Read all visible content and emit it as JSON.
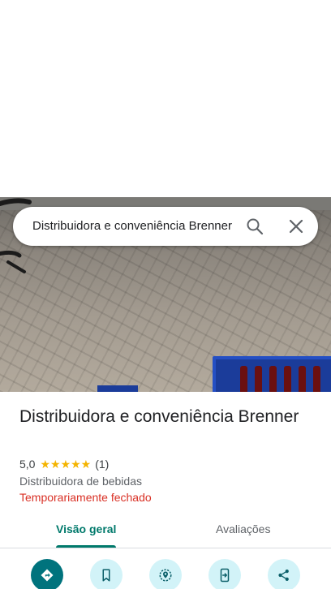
{
  "search": {
    "query": "Distribuidora e conveniência Brenner"
  },
  "place": {
    "title": "Distribuidora e conveniência Brenner",
    "rating": "5,0",
    "stars": "★★★★★",
    "review_count": "(1)",
    "category": "Distribuidora de bebidas",
    "status": "Temporariamente fechado"
  },
  "tabs": [
    {
      "label": "Visão geral",
      "active": true
    },
    {
      "label": "Avaliações",
      "active": false
    }
  ],
  "actions": [
    {
      "icon": "directions-icon"
    },
    {
      "icon": "bookmark-icon"
    },
    {
      "icon": "nearby-icon"
    },
    {
      "icon": "send-to-phone-icon"
    },
    {
      "icon": "share-icon"
    }
  ],
  "colors": {
    "accent": "#00796b",
    "status_closed": "#d93025",
    "star": "#f4b400",
    "action_bg": "#d2f3f8",
    "action_primary_bg": "#00737d"
  }
}
